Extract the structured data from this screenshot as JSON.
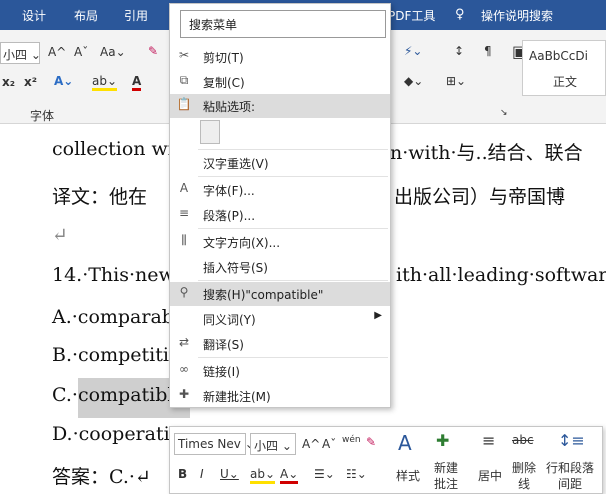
{
  "tabs": {
    "design": "设计",
    "layout": "布局",
    "references": "引用",
    "pdf": "PDF工具",
    "tellme": "操作说明搜索"
  },
  "ribbon": {
    "font_size": "小四",
    "group_font": "字体",
    "style_preview": "AaBbCcDi",
    "style_name": "正文"
  },
  "doc": {
    "line1_left": "collection wi",
    "line1_right": "n·with·与..结合、联合",
    "line2_left": "译文：他在",
    "line2_right": "出版公司）与帝国博",
    "para_mark": "↵",
    "line3_left": "14.·This·new",
    "line3_right": "ith·all·leading·software.",
    "optA": "A.·comparab",
    "optB": "B.·competitiv",
    "optC": "C.·compatibl",
    "optD": "D.·cooperativ",
    "answer": "答案：C.·↵"
  },
  "menu": {
    "search_placeholder": "搜索菜单",
    "cut": "剪切(T)",
    "copy": "复制(C)",
    "paste_options": "粘贴选项:",
    "reconvert": "汉字重选(V)",
    "font": "字体(F)...",
    "paragraph": "段落(P)...",
    "text_direction": "文字方向(X)...",
    "insert_symbol": "插入符号(S)",
    "search_item": "搜索(H)\"compatible\"",
    "synonyms": "同义词(Y)",
    "translate": "翻译(S)",
    "link": "链接(I)",
    "new_comment": "新建批注(M)"
  },
  "mini": {
    "font_name": "Times Nev",
    "font_size": "小四",
    "styles": "样式",
    "new_comment_1": "新建",
    "new_comment_2": "批注",
    "center": "居中",
    "strike_1": "删除",
    "strike_2": "线",
    "spacing_1": "行和段落",
    "spacing_2": "间距"
  }
}
